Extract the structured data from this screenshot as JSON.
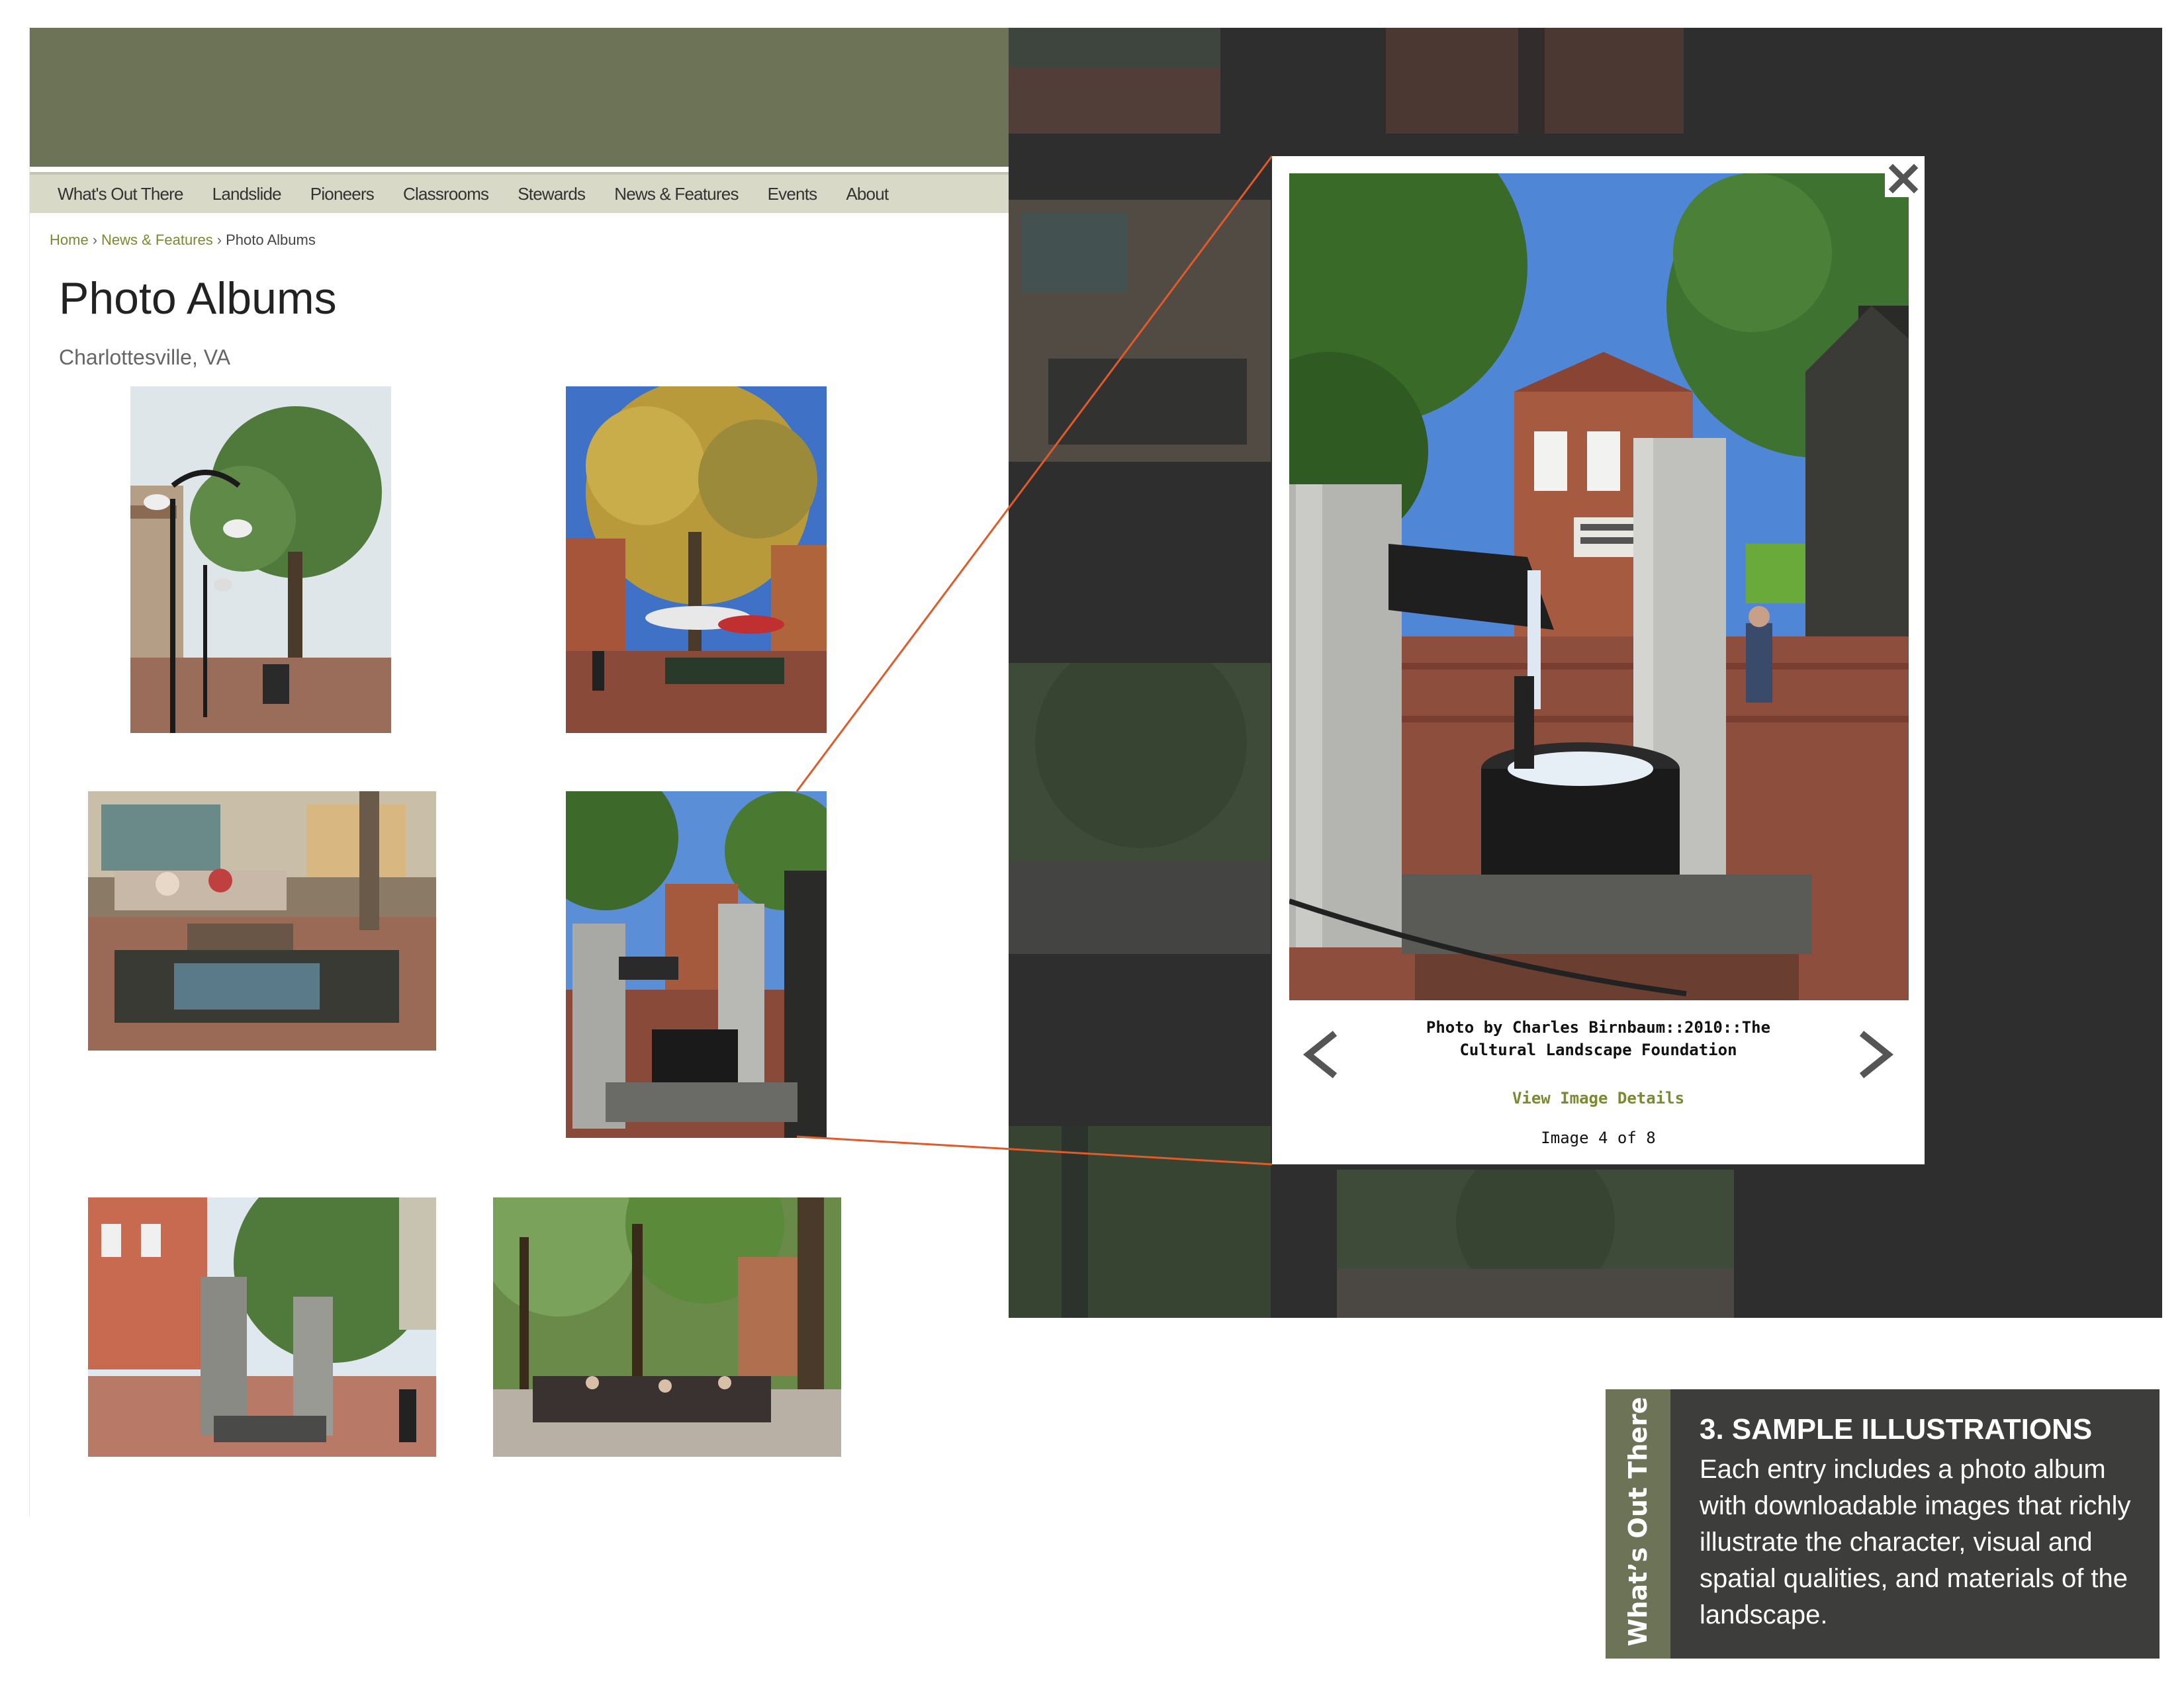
{
  "nav": {
    "items": [
      "What's Out There",
      "Landslide",
      "Pioneers",
      "Classrooms",
      "Stewards",
      "News & Features",
      "Events",
      "About"
    ]
  },
  "breadcrumb": {
    "home": "Home",
    "section": "News & Features",
    "current": "Photo Albums",
    "separator": "›"
  },
  "page": {
    "title": "Photo Albums",
    "location": "Charlottesville, VA"
  },
  "album": {
    "thumbnails": [
      {
        "subject": "street lamps and tree on pedestrian mall"
      },
      {
        "subject": "autumn tree with umbrellas and cafe tables"
      },
      {
        "subject": "stone block fountain with outdoor diners"
      },
      {
        "subject": "black granite fountain between stone slabs"
      },
      {
        "subject": "stone slab fountain on brick plaza"
      },
      {
        "subject": "tree-lined mall with outdoor seating"
      }
    ]
  },
  "lightbox": {
    "caption_line1": "Photo by Charles Birnbaum::2010::The",
    "caption_line2": "Cultural Landscape Foundation",
    "view_details": "View Image Details",
    "counter": "Image 4 of 8",
    "prev_icon": "chevron-left-icon",
    "next_icon": "chevron-right-icon",
    "close_icon": "close-icon"
  },
  "card": {
    "tab_label": "What’s Out There",
    "heading": "3. SAMPLE ILLUSTRATIONS",
    "body": "Each entry includes a photo album with downloadable images that richly illustrate the character, visual and spatial qualities, and materials of the landscape."
  },
  "colors": {
    "header_olive": "#6c7356",
    "nav_bg": "#d9d9c8",
    "link_green": "#7a8a2e",
    "overlay_dark": "#2e2e2e",
    "card_bg": "#3d3d3b",
    "connector_orange": "#e05a2a"
  }
}
